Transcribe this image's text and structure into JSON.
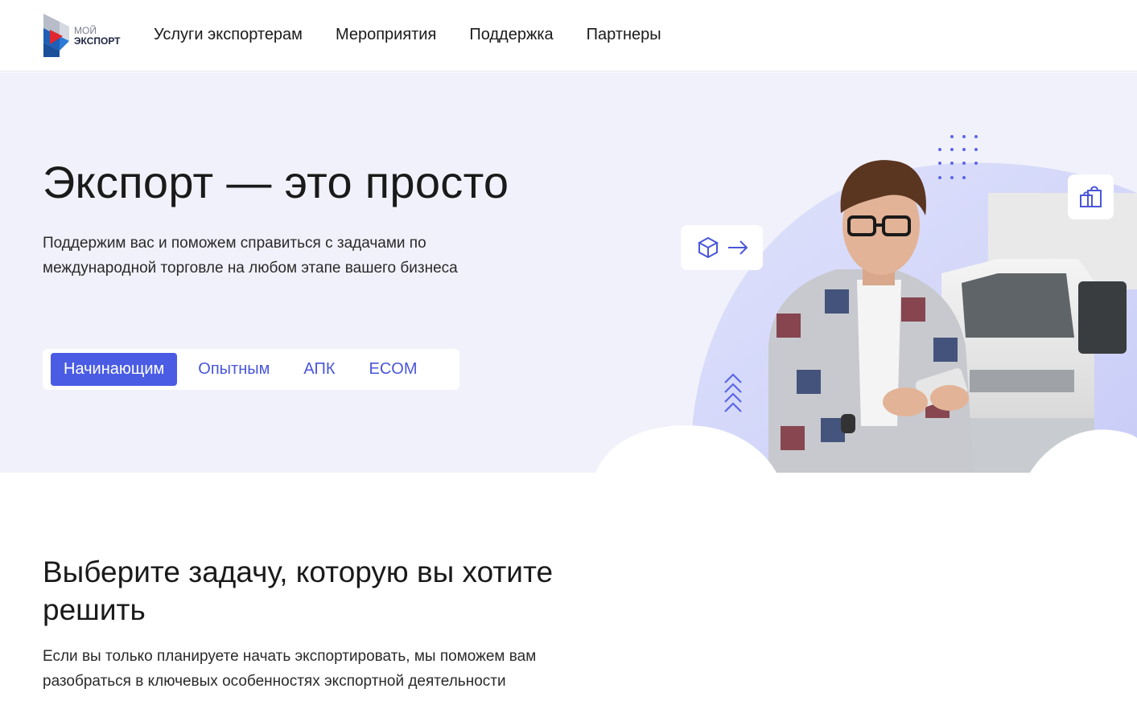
{
  "header": {
    "logo": {
      "line1": "МОЙ",
      "line2": "ЭКСПОРТ"
    },
    "nav": [
      {
        "label": "Услуги экспортерам"
      },
      {
        "label": "Мероприятия"
      },
      {
        "label": "Поддержка"
      },
      {
        "label": "Партнеры"
      }
    ]
  },
  "hero": {
    "title": "Экспорт — это просто",
    "subtitle": "Поддержим вас и поможем справиться с задачами по международной торговле на любом этапе вашего бизнеса",
    "tabs": [
      {
        "label": "Начинающим",
        "active": true
      },
      {
        "label": "Опытным",
        "active": false
      },
      {
        "label": "АПК",
        "active": false
      },
      {
        "label": "ECOM",
        "active": false
      }
    ],
    "illustration_icons": [
      "box-arrow-icon",
      "shopping-bags-icon",
      "chevrons-up-icon",
      "dots-grid-icon"
    ]
  },
  "section": {
    "title": "Выберите задачу, которую вы хотите решить",
    "subtitle": "Если вы только планируете начать экспортировать, мы поможем вам разобраться в ключевых особенностях экспортной деятельности"
  },
  "colors": {
    "accent": "#4a5ce4",
    "hero_bg": "#f1f1fb",
    "text": "#1a1a1a"
  }
}
